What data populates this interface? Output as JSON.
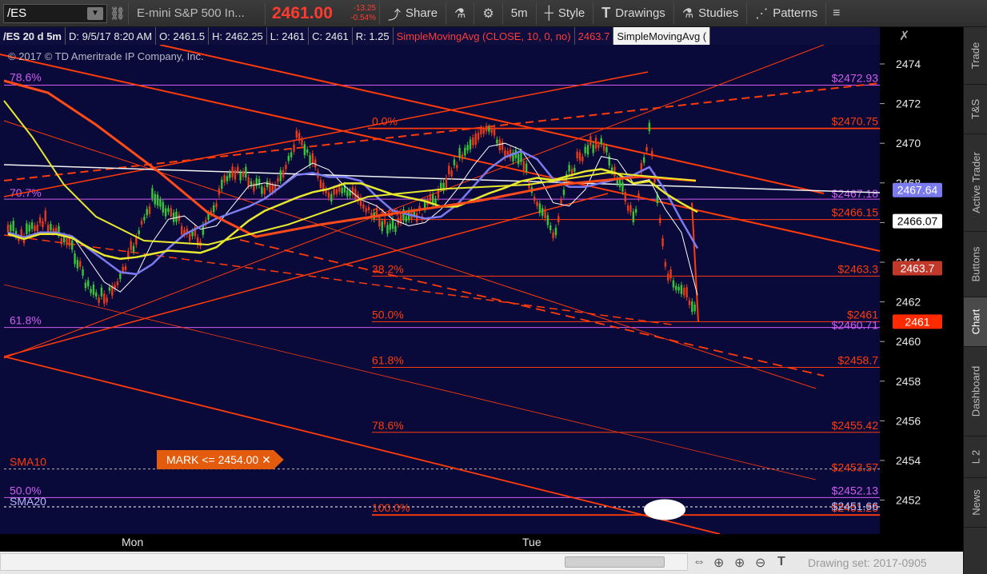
{
  "toolbar": {
    "symbol": "/ES",
    "description": "E-mini S&P 500 In...",
    "last_price": "2461.00",
    "net_change": "-13.25",
    "pct_change": "-0.54%",
    "share_label": "Share",
    "aggregation": "5m",
    "style_label": "Style",
    "drawings_label": "Drawings",
    "studies_label": "Studies",
    "patterns_label": "Patterns"
  },
  "infobar": {
    "symbol_period": "/ES 20 d 5m",
    "datetime": "D: 9/5/17 8:20 AM",
    "open": "O: 2461.5",
    "high": "H: 2462.25",
    "low": "L: 2461",
    "close": "C: 2461",
    "range": "R: 1.25",
    "study1": "SimpleMovingAvg (CLOSE, 10, 0, no)",
    "study1_value": "2463.7",
    "study2": "SimpleMovingAvg ("
  },
  "copyright": "© 2017 © TD Ameritrade IP Company, Inc.",
  "fib_left": {
    "p786": "78.6%",
    "p707": "70.7%",
    "p618": "61.8%",
    "p50": "50.0%"
  },
  "fib_right_levels": [
    {
      "label": "0.0%",
      "price": "$2470.75"
    },
    {
      "label": "23.6%",
      "price": "$2466.15"
    },
    {
      "label": "38.2%",
      "price": "$2463.3"
    },
    {
      "label": "50.0%",
      "price": "$2461"
    },
    {
      "label": "61.8%",
      "price": "$2458.7"
    },
    {
      "label": "78.6%",
      "price": "$2455.42"
    },
    {
      "label": "100.0%",
      "price": "$2451.25"
    }
  ],
  "purple_prices": {
    "p1": "$2472.93",
    "p2": "$2467.18",
    "p3": "$2460.71",
    "p4": "$2452.13",
    "p5": "$2451.66"
  },
  "sma_labels": {
    "sma10": "SMA10",
    "sma20": "SMA20",
    "sma10_price": "$2453.57"
  },
  "alert_mark": "MARK <= 2454.00 ✕",
  "y_axis": {
    "ticks": [
      "2474",
      "2472",
      "2470",
      "2468",
      "2466",
      "2464",
      "2462",
      "2460",
      "2458",
      "2456",
      "2454",
      "2452"
    ],
    "bubbles": [
      {
        "value": "2467.64",
        "color": "#7b7bf0"
      },
      {
        "value": "2466.07",
        "color": "#ffffff"
      },
      {
        "value": "2463.7",
        "color": "#c0392b"
      },
      {
        "value": "2461",
        "color": "#ff2a00"
      }
    ]
  },
  "x_axis": {
    "labels": [
      "Mon",
      "Tue"
    ]
  },
  "sidebar_tabs": [
    "Trade",
    "T&S",
    "Active Trader",
    "Buttons",
    "Chart",
    "Dashboard",
    "L 2",
    "News"
  ],
  "drawing_set": "Drawing set: 2017-0905",
  "chart_data": {
    "type": "line",
    "symbol": "/ES",
    "aggregation": "5m",
    "price_range": [
      2451,
      2475
    ],
    "last": 2461,
    "sma10_last": 2463.7,
    "fib_levels": [
      2470.75,
      2466.15,
      2463.3,
      2461,
      2458.7,
      2455.42,
      2451.25
    ],
    "series": [
      {
        "name": "price",
        "values": [
          2465.5,
          2465,
          2466,
          2465.5,
          2464.5,
          2462.5,
          2462,
          2463,
          2465,
          2467,
          2466.5,
          2465.5,
          2465,
          2467,
          2468.5,
          2468,
          2467.5,
          2468,
          2470,
          2469,
          2467,
          2467.5,
          2467,
          2466,
          2465.5,
          2466,
          2466.5,
          2467.5,
          2469,
          2470,
          2470.5,
          2469.5,
          2469,
          2467,
          2465,
          2468.5,
          2469.5,
          2470,
          2468,
          2466,
          2470.5,
          2463.5,
          2462.5,
          2461
        ]
      }
    ]
  }
}
